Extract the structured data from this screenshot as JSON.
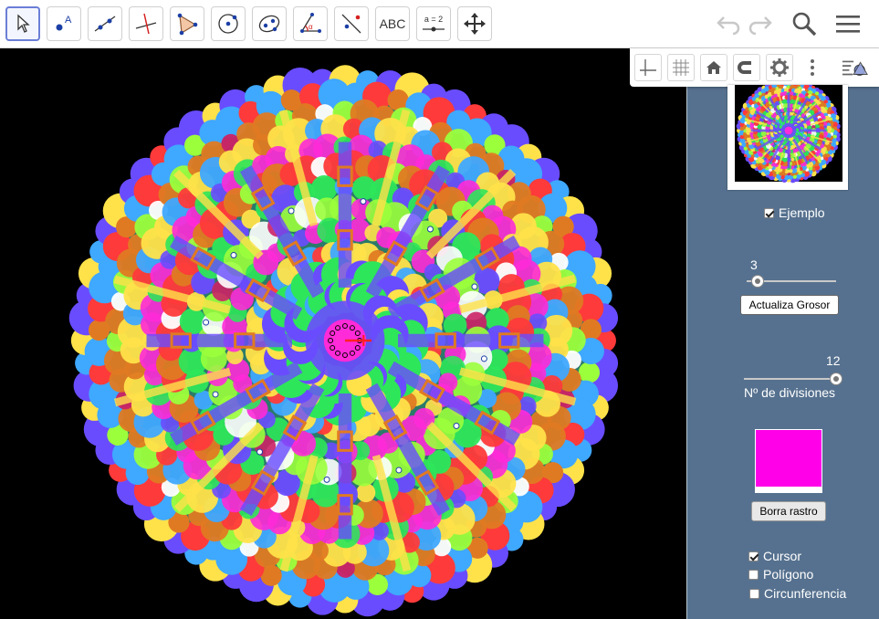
{
  "toolbar": {
    "tools": [
      {
        "name": "move",
        "icon": "arrow-cursor-icon"
      },
      {
        "name": "point",
        "icon": "point-icon",
        "label": "A"
      },
      {
        "name": "line",
        "icon": "line-icon"
      },
      {
        "name": "perpendicular",
        "icon": "perpendicular-line-icon"
      },
      {
        "name": "polygon",
        "icon": "polygon-icon"
      },
      {
        "name": "circle",
        "icon": "circle-center-icon"
      },
      {
        "name": "ellipse",
        "icon": "ellipse-icon"
      },
      {
        "name": "angle",
        "icon": "angle-icon",
        "label": "α"
      },
      {
        "name": "reflect",
        "icon": "reflect-icon"
      },
      {
        "name": "text",
        "icon": "text-icon",
        "label": "ABC"
      },
      {
        "name": "slider",
        "icon": "slider-icon",
        "label": "a = 2"
      },
      {
        "name": "move-graphics",
        "icon": "move-view-icon"
      }
    ],
    "right_icons": [
      "undo-icon",
      "redo-icon",
      "search-icon",
      "menu-icon"
    ]
  },
  "style_bar": {
    "icons": [
      "axes-icon",
      "grid-icon",
      "home-icon",
      "point-capture-icon",
      "gear-icon",
      "more-icon",
      "toggle-algebra-icon"
    ]
  },
  "panel": {
    "ejemplo": {
      "label": "Ejemplo",
      "checked": true
    },
    "grosor_slider": {
      "value": "3",
      "fraction": 0.0
    },
    "actualiza_button": "Actualiza Grosor",
    "divisiones_slider": {
      "value": "12",
      "label": "Nº de divisiones",
      "fraction": 1.0
    },
    "color_swatch": "#ff00e8",
    "borra_button": "Borra rastro",
    "checkboxes": [
      {
        "label": "Cursor",
        "checked": true
      },
      {
        "label": "Polígono",
        "checked": false
      },
      {
        "label": "Circunferencia",
        "checked": false
      }
    ]
  },
  "colors": {
    "panel_bg": "#56718f",
    "graphics_bg": "#000000",
    "selected_tool_border": "#6b7fd6",
    "mandala_palette": [
      "#ff2ad8",
      "#2ee65a",
      "#6a4cff",
      "#ffe24a",
      "#3fa8ff",
      "#ff3a3a",
      "#e07a22",
      "#9bff3c",
      "#ffffff",
      "#cc2266"
    ]
  }
}
